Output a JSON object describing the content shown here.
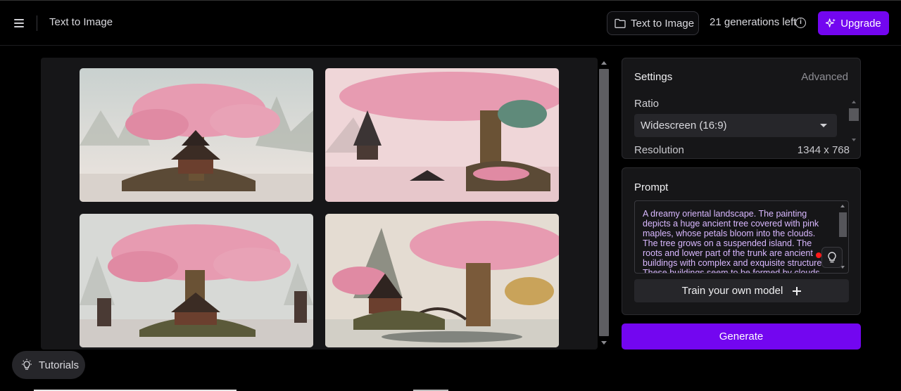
{
  "header": {
    "page_title": "Text to Image",
    "tool_button_label": "Text to Image",
    "generations_left": "21 generations left",
    "upgrade_label": "Upgrade"
  },
  "gallery": {
    "images": [
      {
        "name": "generated-image-1"
      },
      {
        "name": "generated-image-2"
      },
      {
        "name": "generated-image-3"
      },
      {
        "name": "generated-image-4"
      }
    ]
  },
  "settings": {
    "title": "Settings",
    "advanced_label": "Advanced",
    "ratio_label": "Ratio",
    "ratio_value": "Widescreen (16:9)",
    "next_row_label": "Resolution",
    "next_row_value": "1344 x 768"
  },
  "prompt": {
    "title": "Prompt",
    "text": "A dreamy oriental landscape. The painting depicts a huge ancient tree covered with pink maples, whose petals bloom into the clouds. The tree grows on a suspended island. The roots and lower part of the trunk are ancient buildings with complex and exquisite structures. These buildings seem to be formed by clouds and mist.",
    "train_label": "Train your own model"
  },
  "generate_label": "Generate",
  "tutorials_label": "Tutorials",
  "colors": {
    "accent": "#7306f0",
    "prompt_text": "#d9b8ff",
    "panel_bg": "#161618"
  },
  "icons": {
    "menu": "hamburger-menu-icon",
    "folder": "folder-icon",
    "info": "info-icon",
    "sparkle": "sparkle-icon",
    "bulb": "lightbulb-icon",
    "plus": "plus-icon",
    "caret": "chevron-down-icon"
  }
}
